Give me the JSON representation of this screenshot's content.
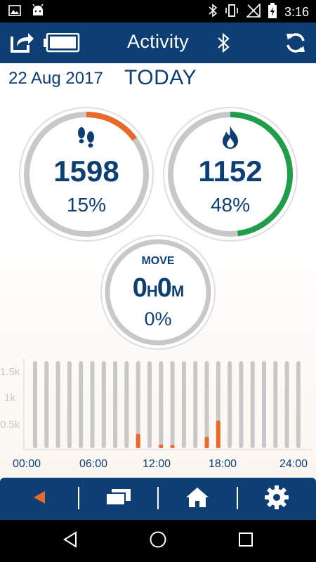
{
  "status_bar": {
    "time": "3:16",
    "icons": [
      "image-icon",
      "android-icon",
      "bluetooth-icon",
      "vibrate-icon",
      "no-signal-icon",
      "battery-charging-icon"
    ]
  },
  "app_bar": {
    "title": "Activity",
    "icons": [
      "share-icon",
      "battery-icon",
      "bluetooth-icon",
      "sync-icon"
    ]
  },
  "header": {
    "date": "22 Aug 2017",
    "today_label": "TODAY"
  },
  "gauges": {
    "steps": {
      "value": "1598",
      "percent_text": "15%",
      "progress": 0.15,
      "color": "#e86a2a",
      "icon": "footsteps-icon"
    },
    "calories": {
      "value": "1152",
      "percent_text": "48%",
      "progress": 0.48,
      "color": "#1e9e48",
      "icon": "flame-icon"
    },
    "move": {
      "label": "MOVE",
      "hours": "0",
      "hours_unit": "H",
      "minutes": "0",
      "minutes_unit": "M",
      "percent_text": "0%",
      "progress": 0
    }
  },
  "chart_data": {
    "type": "bar",
    "y_tick_labels": [
      "1.5k",
      "1k",
      "0.5k"
    ],
    "y_ticks": [
      1500,
      1000,
      500
    ],
    "ylim": [
      0,
      1700
    ],
    "x_tick_labels": [
      "00:00",
      "06:00",
      "12:00",
      "18:00",
      "24:00"
    ],
    "bar_count": 24,
    "values": [
      0,
      0,
      0,
      0,
      0,
      0,
      0,
      0,
      0,
      280,
      0,
      70,
      60,
      0,
      0,
      220,
      540,
      0,
      0,
      0,
      0,
      0,
      0,
      0
    ],
    "bar_color": "#e86a2a",
    "track_color": "#c8c8c8"
  },
  "bottom_bar": {
    "icons": [
      "back-arrow-icon",
      "windows-icon",
      "home-icon",
      "settings-icon"
    ],
    "accent": "#e86a2a"
  },
  "nav_bar": {
    "icons": [
      "nav-back-icon",
      "nav-home-icon",
      "nav-recents-icon"
    ]
  }
}
